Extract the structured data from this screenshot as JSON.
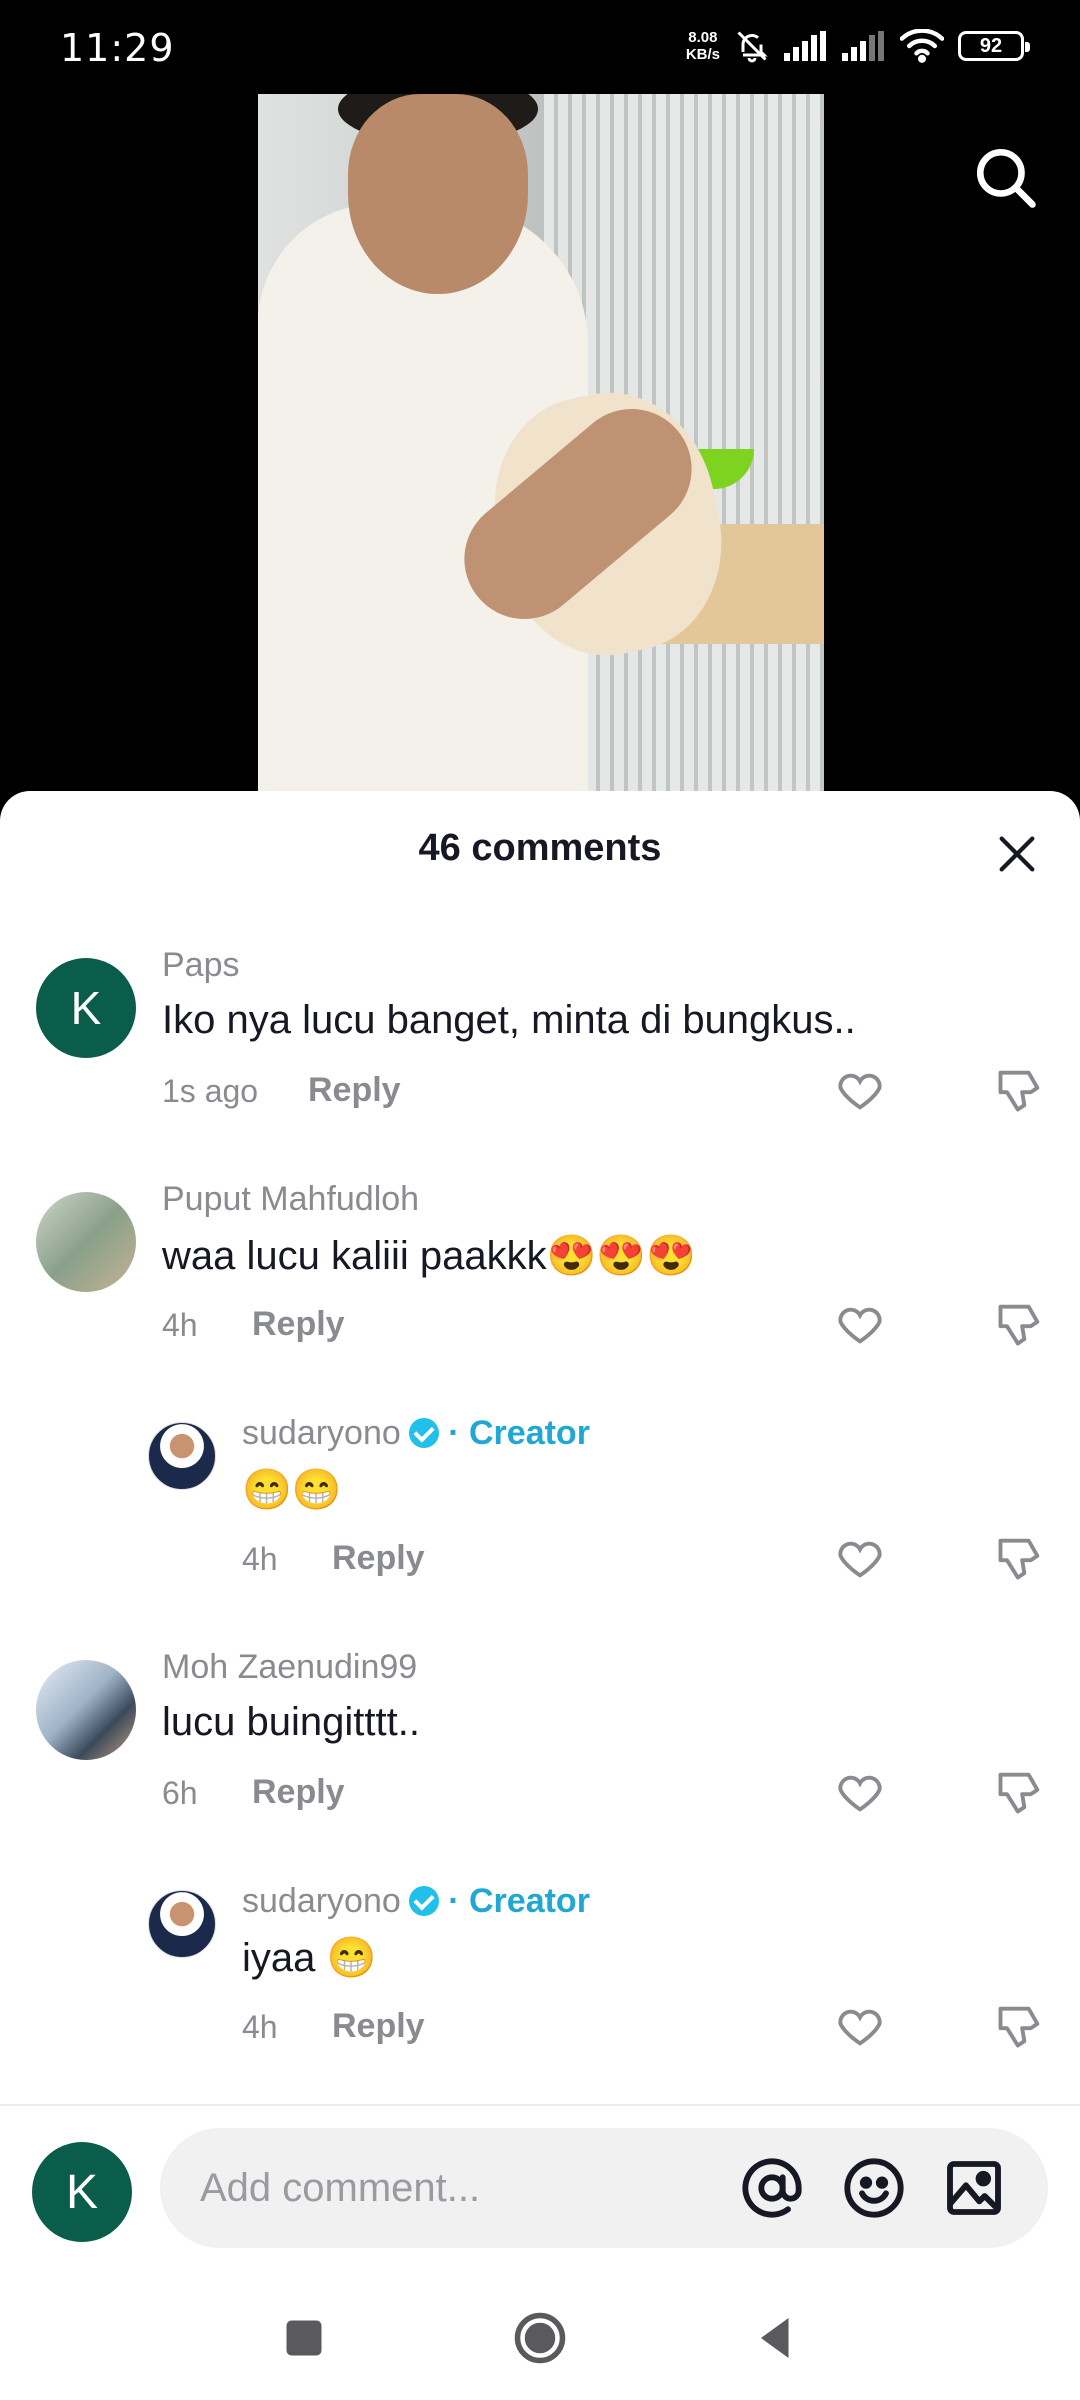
{
  "status_bar": {
    "time": "11:29",
    "net_speed_value": "8.08",
    "net_speed_unit": "KB/s",
    "battery": "92",
    "icons": [
      "bell-off-icon",
      "signal-icon",
      "signal-icon",
      "wifi-icon",
      "battery-icon"
    ]
  },
  "video": {
    "search_icon": "search-icon"
  },
  "sheet": {
    "title": "46 comments",
    "close_icon": "close-icon"
  },
  "comments": [
    {
      "avatar_letter": "K",
      "user": "Paps",
      "text": "Iko nya lucu banget, minta di bungkus..",
      "time": "1s ago",
      "reply": "Reply"
    },
    {
      "user": "Puput Mahfudloh",
      "text": "waa lucu kaliii paakkk😍😍😍",
      "time": "4h",
      "reply": "Reply"
    },
    {
      "user": "sudaryono",
      "creator_tag": "· Creator",
      "text": "😁😁",
      "time": "4h",
      "reply": "Reply"
    },
    {
      "user": "Moh Zaenudin99",
      "text": "lucu buingitttt..",
      "time": "6h",
      "reply": "Reply"
    },
    {
      "user": "sudaryono",
      "creator_tag": "· Creator",
      "text": "iyaa 😁",
      "time": "4h",
      "reply": "Reply"
    }
  ],
  "composer": {
    "avatar_letter": "K",
    "placeholder": "Add comment...",
    "icons": [
      "mention-icon",
      "emoji-icon",
      "image-icon"
    ]
  },
  "nav": {
    "icons": [
      "recents-icon",
      "home-icon",
      "back-icon"
    ]
  },
  "colors": {
    "accent_creator": "#20a7d4",
    "avatar_bg": "#0b5d4b",
    "verified": "#20c0ea"
  }
}
